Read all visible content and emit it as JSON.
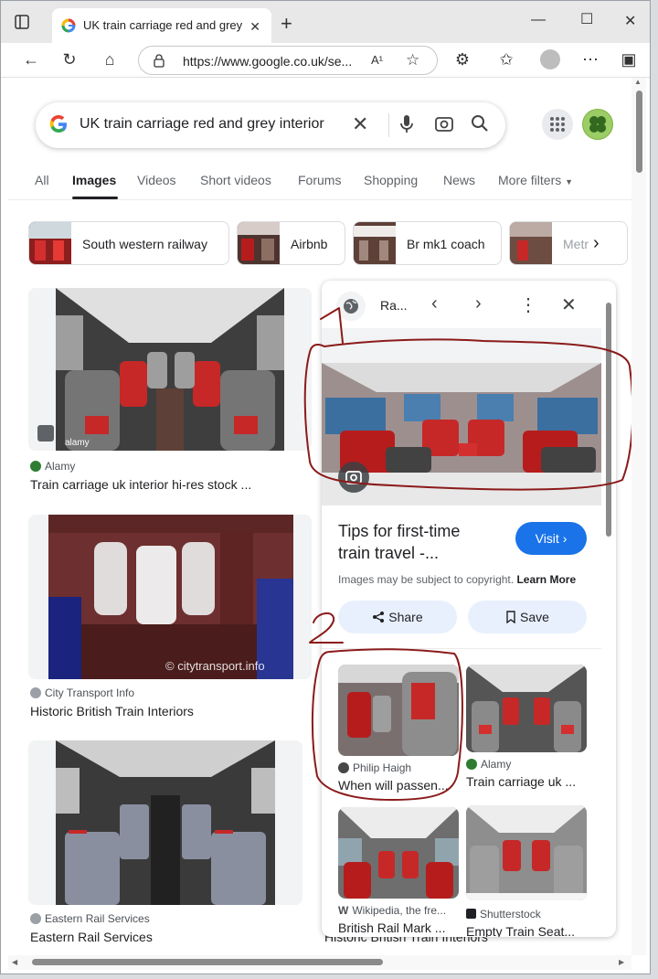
{
  "browser": {
    "tab_title": "UK train carriage red and grey int",
    "url": "https://www.google.co.uk/se...",
    "read_aloud": "A¹"
  },
  "search": {
    "query": "UK train carriage red and grey interior"
  },
  "nav_tabs": [
    "All",
    "Images",
    "Videos",
    "Short videos",
    "Forums",
    "Shopping",
    "News",
    "More filters"
  ],
  "chips": [
    "South western railway",
    "Airbnb",
    "Br mk1 coach",
    "Metr"
  ],
  "results": [
    {
      "source": "Alamy",
      "title": "Train carriage uk interior hi-res stock ...",
      "watermark": "alamy"
    },
    {
      "source": "City Transport Info",
      "title": "Historic British Train Interiors",
      "watermark": "© citytransport.info"
    },
    {
      "source": "Eastern Rail Services",
      "title": "Eastern Rail Services"
    }
  ],
  "panel": {
    "header_title": "Ra...",
    "title_line1": "Tips for first-time",
    "title_line2": "train travel -...",
    "visit_label": "Visit",
    "copyright_text": "Images may be subject to copyright.",
    "learn_more": "Learn More",
    "share_label": "Share",
    "save_label": "Save",
    "related": [
      {
        "source": "Philip Haigh",
        "title": "When will passen..."
      },
      {
        "source": "Alamy",
        "title": "Train carriage uk ..."
      },
      {
        "source": "Wikipedia, the fre...",
        "title": "British Rail Mark ..."
      },
      {
        "source": "Shutterstock",
        "title": "Empty Train Seat..."
      }
    ]
  },
  "overflow_title": "Historic British Train Interiors",
  "annotations": {
    "one": "1",
    "two": "2"
  },
  "colors": {
    "accent": "#1a73e8",
    "seat_red": "#c62828",
    "annotation": "#8b1a1a"
  }
}
